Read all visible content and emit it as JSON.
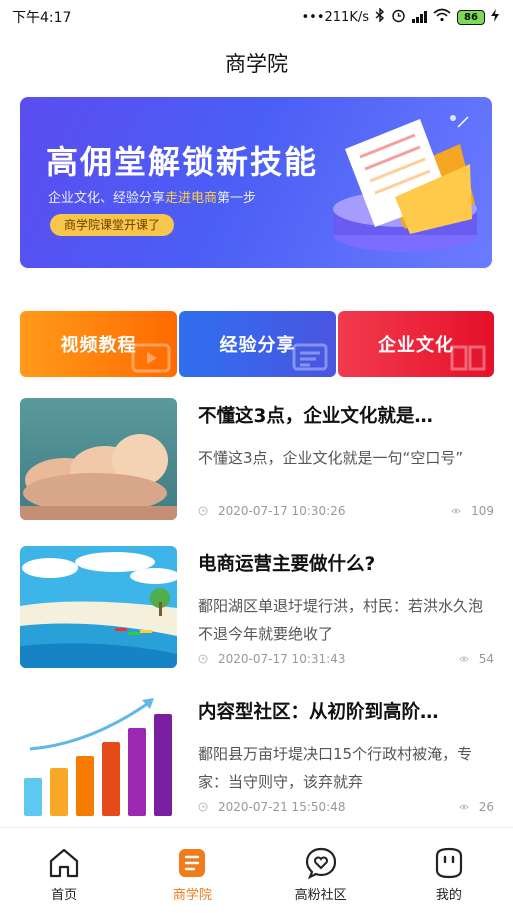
{
  "status_bar": {
    "time": "下午4:17",
    "network_speed": "•••211K/s",
    "battery": "86"
  },
  "header": {
    "title": "商学院"
  },
  "banner": {
    "title": "高佣堂解锁新技能",
    "subtitle_prefix": "企业文化、经验分享",
    "subtitle_highlight": "走进电商",
    "subtitle_suffix": "第一步",
    "button": "商学院课堂开课了"
  },
  "categories": [
    {
      "label": "视频教程"
    },
    {
      "label": "经验分享"
    },
    {
      "label": "企业文化"
    }
  ],
  "articles": [
    {
      "title": "不懂这3点，企业文化就是…",
      "desc": "不懂这3点，企业文化就是一句“空口号”",
      "date": "2020-07-17 10:30:26",
      "views": "109"
    },
    {
      "title": "电商运营主要做什么?",
      "desc": "鄱阳湖区单退圩堤行洪，村民：若洪水久泡不退今年就要绝收了",
      "date": "2020-07-17 10:31:43",
      "views": "54"
    },
    {
      "title": "内容型社区：从初阶到高阶…",
      "desc": "鄱阳县万亩圩堤决口15个行政村被淹，专家：当守则守，该弃就弃",
      "date": "2020-07-21 15:50:48",
      "views": "26"
    }
  ],
  "bottom_nav": [
    {
      "label": "首页",
      "icon": "home-icon"
    },
    {
      "label": "商学院",
      "icon": "business-school-icon"
    },
    {
      "label": "高粉社区",
      "icon": "community-heart-icon"
    },
    {
      "label": "我的",
      "icon": "profile-icon"
    }
  ],
  "colors": {
    "accent": "#f07b1a",
    "video": "#ff7a0a",
    "share": "#3a62e8",
    "culture": "#ec2436"
  }
}
